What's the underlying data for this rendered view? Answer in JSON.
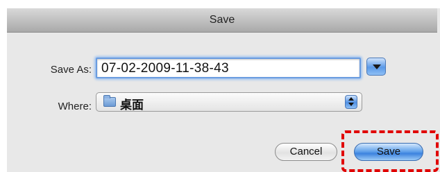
{
  "window": {
    "title": "Save"
  },
  "form": {
    "save_as_label": "Save As:",
    "filename_value": "07-02-2009-11-38-43",
    "where_label": "Where:",
    "where_value": "桌面"
  },
  "buttons": {
    "cancel_label": "Cancel",
    "save_label": "Save"
  },
  "colors": {
    "highlight": "#e00000",
    "default_button": "#3c82de"
  },
  "icons": {
    "expand": "disclosure-triangle-icon",
    "folder": "folder-icon",
    "popup_arrows": "up-down-arrows-icon"
  }
}
